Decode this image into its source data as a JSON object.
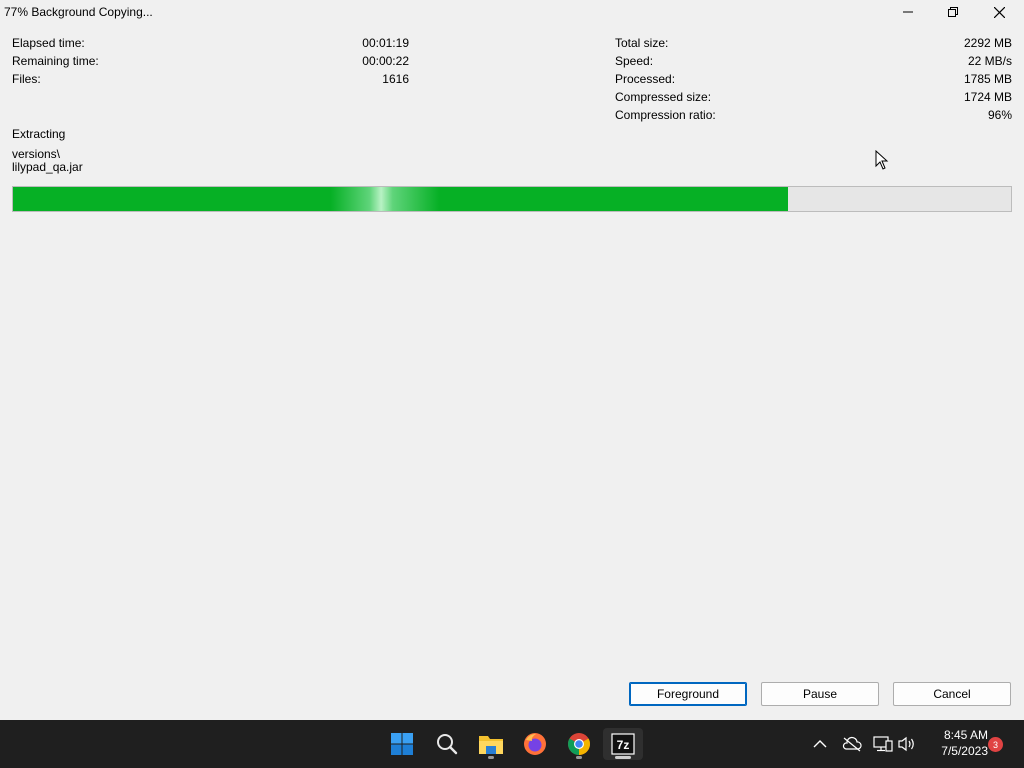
{
  "window": {
    "title": "77% Background Copying..."
  },
  "stats_left": [
    {
      "label": "Elapsed time:",
      "value": "00:01:19"
    },
    {
      "label": "Remaining time:",
      "value": "00:00:22"
    },
    {
      "label": "Files:",
      "value": "1616"
    }
  ],
  "stats_right": [
    {
      "label": "Total size:",
      "value": "2292 MB"
    },
    {
      "label": "Speed:",
      "value": "22 MB/s"
    },
    {
      "label": "Processed:",
      "value": "1785 MB"
    },
    {
      "label": "Compressed size:",
      "value": "1724 MB"
    },
    {
      "label": "Compression ratio:",
      "value": "96%"
    }
  ],
  "operation": {
    "status": "Extracting",
    "path_line1": "versions\\",
    "path_line2": "lilypad_qa.jar"
  },
  "progress": {
    "fraction": 0.777,
    "color": "#06b025"
  },
  "buttons": {
    "foreground": "Foreground",
    "pause": "Pause",
    "cancel": "Cancel"
  },
  "taskbar": {
    "icons": [
      "windows-start-icon",
      "search-icon",
      "file-explorer-icon",
      "firefox-icon",
      "chrome-icon",
      "7zip-icon"
    ],
    "tray_icons": [
      "chevron-up-icon",
      "cloud-off-icon",
      "network-icon",
      "speaker-icon"
    ],
    "time": "8:45 AM",
    "date": "7/5/2023",
    "notification_count": "3"
  }
}
